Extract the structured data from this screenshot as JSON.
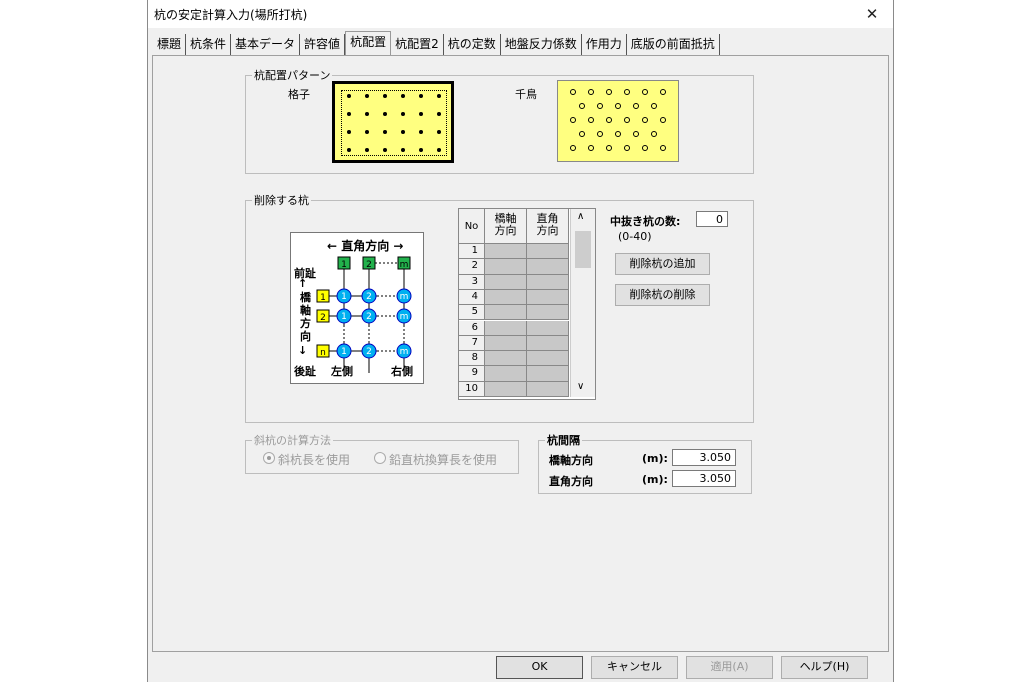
{
  "window": {
    "title": "杭の安定計算入力(場所打杭)",
    "close_glyph": "✕"
  },
  "tabs": [
    {
      "label": "標題"
    },
    {
      "label": "杭条件"
    },
    {
      "label": "基本データ"
    },
    {
      "label": "許容値"
    },
    {
      "label": "杭配置",
      "active": true
    },
    {
      "label": "杭配置2"
    },
    {
      "label": "杭の定数"
    },
    {
      "label": "地盤反力係数"
    },
    {
      "label": "作用力"
    },
    {
      "label": "底版の前面抵抗"
    }
  ],
  "pattern": {
    "group_label": "杭配置パターン",
    "grid_label": "格子",
    "staggered_label": "千鳥",
    "selected": "格子"
  },
  "delete": {
    "group_label": "削除する杭",
    "diagram": {
      "top_label": "← 直角方向 →",
      "left_top": "前趾",
      "left_mid": [
        "橋",
        "軸",
        "方",
        "向"
      ],
      "left_bottom": "後趾",
      "left_side": "左側",
      "right_side": "右側",
      "col_labels": [
        "1",
        "2",
        "m"
      ],
      "row_labels": [
        "1",
        "2",
        "n"
      ]
    },
    "table": {
      "headers": {
        "no": "No",
        "col1": "橋軸方向",
        "col2": "直角方向"
      },
      "rows": [
        "1",
        "2",
        "3",
        "4",
        "5",
        "6",
        "7",
        "8",
        "9",
        "10"
      ]
    },
    "hollow_label": "中抜き杭の数:",
    "hollow_value": "0",
    "hollow_range": "(0-40)",
    "add_button": "削除杭の追加",
    "remove_button": "削除杭の削除"
  },
  "slant": {
    "group_label": "斜杭の計算方法",
    "option1": "斜杭長を使用",
    "option2": "鉛直杭換算長を使用",
    "selected": 1
  },
  "spacing": {
    "group_label": "杭間隔",
    "bridge_label": "橋軸方向",
    "bridge_unit": "(m):",
    "bridge_value": "3.050",
    "perp_label": "直角方向",
    "perp_unit": "(m):",
    "perp_value": "3.050"
  },
  "footer": {
    "ok": "OK",
    "cancel": "キャンセル",
    "apply": "適用(A)",
    "help": "ヘルプ(H)"
  },
  "colors": {
    "pattern_bg": "#ffff80",
    "pile_circle": "#00b0f0",
    "label_green": "#22b14c",
    "label_yellow": "#ffff00"
  }
}
